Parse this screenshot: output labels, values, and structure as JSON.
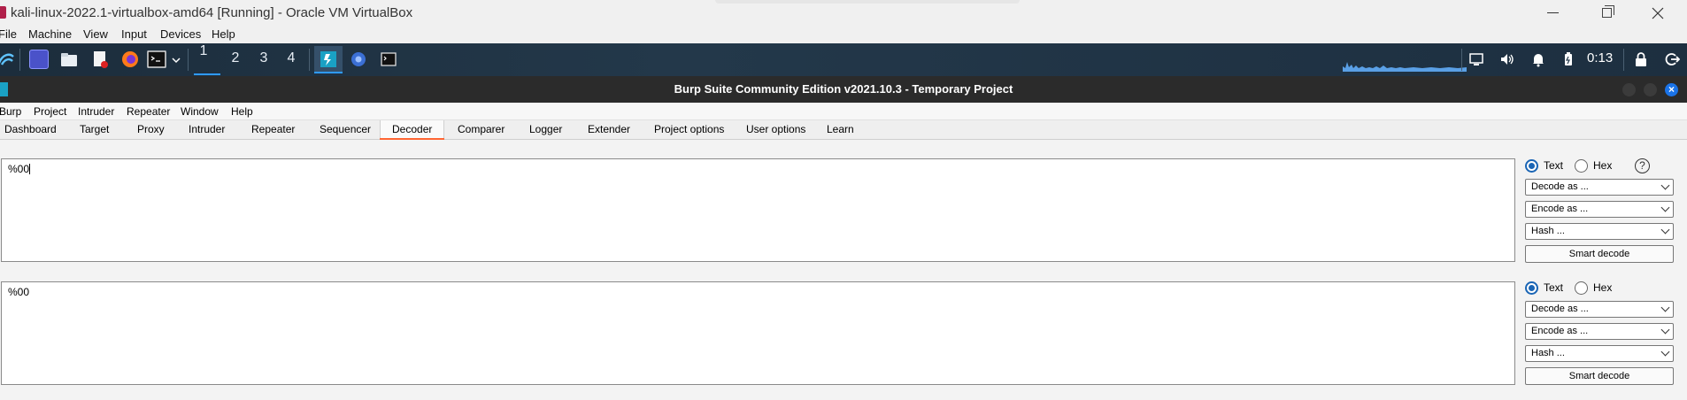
{
  "vbox": {
    "title": "kali-linux-2022.1-virtualbox-amd64 [Running] - Oracle VM VirtualBox",
    "menu": [
      "File",
      "Machine",
      "View",
      "Input",
      "Devices",
      "Help"
    ]
  },
  "kali_panel": {
    "workspaces": [
      "1",
      "2",
      "3",
      "4"
    ],
    "active_workspace": "1",
    "clock": "0:13",
    "icons": [
      "kali-menu-icon",
      "desktop-icon",
      "file-manager-icon",
      "text-editor-icon",
      "firefox-icon",
      "terminal-icon",
      "burp-suite-icon",
      "chromium-icon",
      "terminal-small-icon",
      "display-icon",
      "volume-icon",
      "bell-icon",
      "battery-icon",
      "lock-icon",
      "logout-icon"
    ]
  },
  "burp": {
    "title": "Burp Suite Community Edition v2021.10.3 - Temporary Project",
    "menu": [
      "Burp",
      "Project",
      "Intruder",
      "Repeater",
      "Window",
      "Help"
    ],
    "tabs": [
      "Dashboard",
      "Target",
      "Proxy",
      "Intruder",
      "Repeater",
      "Sequencer",
      "Decoder",
      "Comparer",
      "Logger",
      "Extender",
      "Project options",
      "User options",
      "Learn"
    ],
    "active_tab": "Decoder",
    "accent_color": "#ff6633"
  },
  "decoder": {
    "panes": [
      {
        "content": "%00",
        "text_label": "Text",
        "hex_label": "Hex",
        "selected_mode": "Text",
        "decode_label": "Decode as ...",
        "encode_label": "Encode as ...",
        "hash_label": "Hash ...",
        "smart_decode_label": "Smart decode"
      },
      {
        "content": "%00",
        "text_label": "Text",
        "hex_label": "Hex",
        "selected_mode": "Text",
        "decode_label": "Decode as ...",
        "encode_label": "Encode as ...",
        "hash_label": "Hash ...",
        "smart_decode_label": "Smart decode"
      }
    ],
    "help_label": "?"
  }
}
